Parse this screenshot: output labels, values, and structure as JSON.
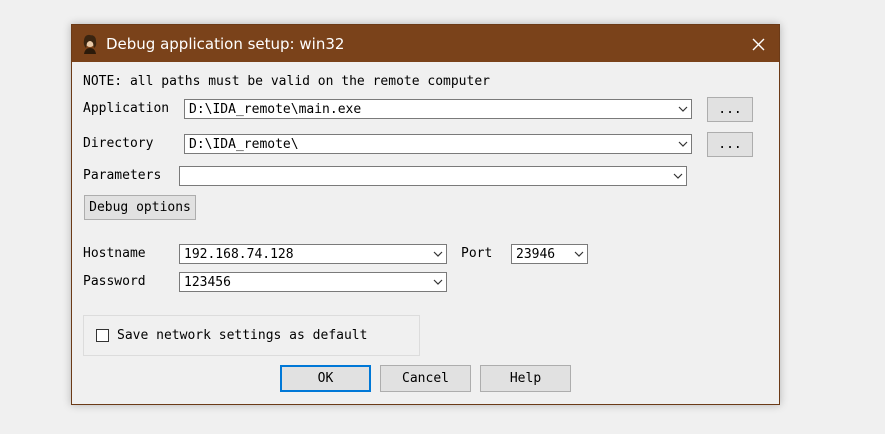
{
  "window": {
    "title": "Debug application setup: win32",
    "icon": "ida-logo-icon",
    "close_glyph": "✕",
    "accent": "#7a421a"
  },
  "note": "NOTE: all paths must be valid on the remote computer",
  "application": {
    "label": "Application",
    "value": "D:\\IDA_remote\\main.exe",
    "browse_label": "..."
  },
  "directory": {
    "label": "Directory",
    "value": "D:\\IDA_remote\\",
    "browse_label": "..."
  },
  "parameters": {
    "label": "Parameters",
    "value": ""
  },
  "debug_options_label": "Debug options",
  "hostname": {
    "label": "Hostname",
    "value": "192.168.74.128"
  },
  "port": {
    "label": "Port",
    "value": "23946"
  },
  "password": {
    "label": "Password",
    "value": "123456"
  },
  "save_network": {
    "label": "Save network settings as default",
    "checked": false
  },
  "buttons": {
    "ok": "OK",
    "cancel": "Cancel",
    "help": "Help"
  }
}
